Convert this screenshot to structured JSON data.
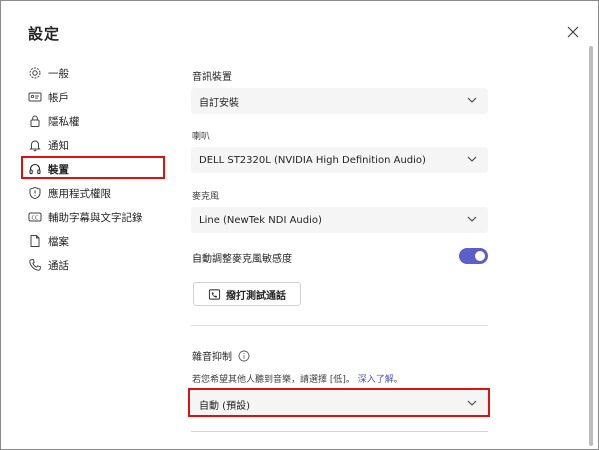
{
  "dialog": {
    "title": "設定",
    "close_icon": "close-icon"
  },
  "nav": {
    "items": [
      {
        "label": "一般",
        "icon": "gear-icon"
      },
      {
        "label": "帳戶",
        "icon": "id-card-icon"
      },
      {
        "label": "隱私權",
        "icon": "lock-icon"
      },
      {
        "label": "通知",
        "icon": "bell-icon"
      },
      {
        "label": "裝置",
        "icon": "headset-icon",
        "active": true
      },
      {
        "label": "應用程式權限",
        "icon": "shield-icon"
      },
      {
        "label": "輔助字幕與文字記錄",
        "icon": "cc-icon"
      },
      {
        "label": "檔案",
        "icon": "file-icon"
      },
      {
        "label": "通話",
        "icon": "phone-icon"
      }
    ]
  },
  "audio": {
    "section_label": "音訊裝置",
    "device_value": "自訂安裝",
    "speaker_label": "喇叭",
    "speaker_value": "DELL ST2320L (NVIDIA High Definition Audio)",
    "mic_label": "麥克風",
    "mic_value": "Line (NewTek NDI Audio)",
    "auto_adjust_label": "自動調整麥克風敏感度",
    "auto_adjust_on": true,
    "test_call_label": "撥打測試通話"
  },
  "noise": {
    "title": "雜音抑制",
    "description": "若您希望其他人聽到音樂，請選擇 [低]。",
    "learn_more": "深入了解",
    "value": "自動 (預設)"
  },
  "colors": {
    "accent": "#5b5fc7",
    "highlight": "#e01010",
    "link": "#4f52b2"
  }
}
